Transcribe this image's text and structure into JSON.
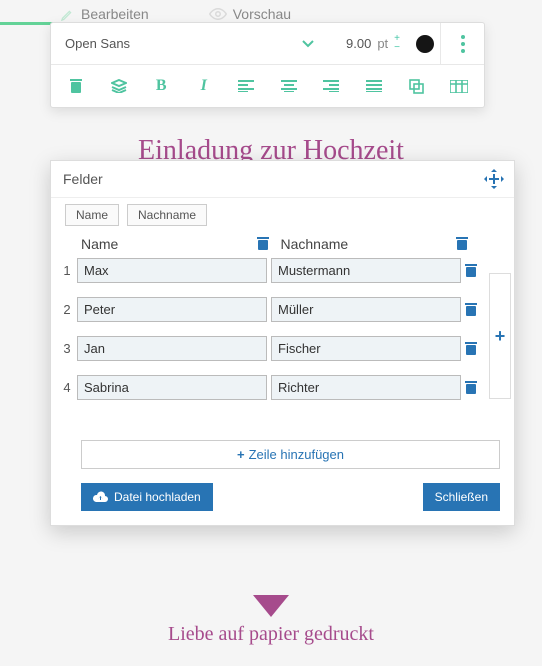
{
  "tabs": {
    "edit": "Bearbeiten",
    "preview": "Vorschau"
  },
  "toolbar": {
    "font": "Open Sans",
    "size_value": "9.00",
    "size_unit": "pt"
  },
  "page": {
    "title": "Einladung zur Hochzeit",
    "subtitle": "Liebe auf papier gedruckt"
  },
  "fields": {
    "title": "Felder",
    "chips": [
      "Name",
      "Nachname"
    ],
    "columns": [
      "Name",
      "Nachname"
    ],
    "rows": [
      {
        "n": "1",
        "first": "Max",
        "last": "Mustermann"
      },
      {
        "n": "2",
        "first": "Peter",
        "last": "Müller"
      },
      {
        "n": "3",
        "first": "Jan",
        "last": "Fischer"
      },
      {
        "n": "4",
        "first": "Sabrina",
        "last": "Richter"
      }
    ],
    "add_row_label": "Zeile hinzufügen",
    "upload_label": "Datei hochladen",
    "close_label": "Schließen"
  }
}
